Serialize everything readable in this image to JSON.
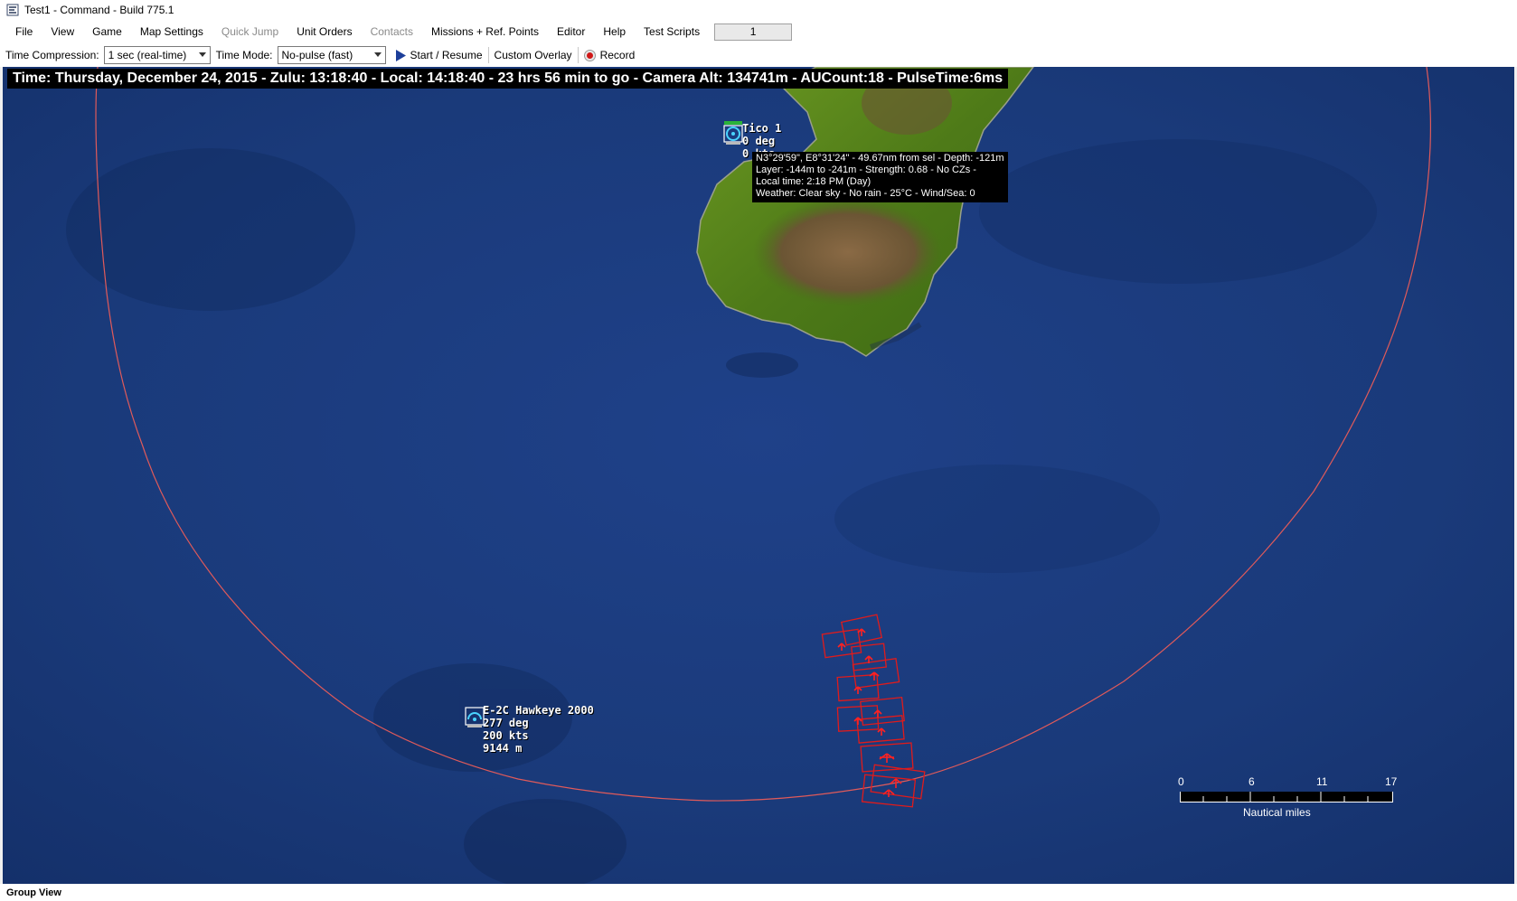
{
  "window": {
    "title": "Test1 - Command - Build 775.1"
  },
  "menu": {
    "items": [
      {
        "label": "File",
        "enabled": true
      },
      {
        "label": "View",
        "enabled": true
      },
      {
        "label": "Game",
        "enabled": true
      },
      {
        "label": "Map Settings",
        "enabled": true
      },
      {
        "label": "Quick Jump",
        "enabled": false
      },
      {
        "label": "Unit Orders",
        "enabled": true
      },
      {
        "label": "Contacts",
        "enabled": false
      },
      {
        "label": "Missions + Ref. Points",
        "enabled": true
      },
      {
        "label": "Editor",
        "enabled": true
      },
      {
        "label": "Help",
        "enabled": true
      },
      {
        "label": "Test Scripts",
        "enabled": true
      }
    ],
    "field_value": "1"
  },
  "toolbar": {
    "time_compression_label": "Time Compression:",
    "time_compression_value": "1 sec (real-time)",
    "time_mode_label": "Time Mode:",
    "time_mode_value": "No-pulse (fast)",
    "start_resume_label": "Start / Resume",
    "custom_overlay_label": "Custom Overlay",
    "record_label": "Record"
  },
  "map": {
    "info_text": "Time: Thursday, December 24, 2015 - Zulu: 13:18:40 - Local: 14:18:40 - 23 hrs 56 min to go -  Camera Alt: 134741m - AUCount:18 - PulseTime:6ms",
    "units": [
      {
        "name": "Tico 1",
        "heading": "0 deg",
        "speed": "0 kts"
      },
      {
        "name": "E-2C Hawkeye 2000",
        "heading": "277 deg",
        "speed": "200 kts",
        "altitude": "9144 m"
      }
    ],
    "tooltip": {
      "line1": "N3°29'59\", E8°31'24\" - 49.67nm from sel - Depth: -121m",
      "line2": "Layer: -144m to -241m - Strength: 0.68 - No CZs -",
      "line3": "Local time: 2:18 PM (Day)",
      "line4": "Weather: Clear sky - No rain - 25°C - Wind/Sea: 0"
    },
    "scale": {
      "ticks": [
        "0",
        "6",
        "11",
        "17"
      ],
      "unit": "Nautical miles"
    },
    "colors": {
      "ocean": "#1b3a7a",
      "range_ring": "#e05a5a",
      "contact": "#e01b1b",
      "land": "#5a8a1e"
    }
  },
  "status": {
    "label": "Group View"
  }
}
